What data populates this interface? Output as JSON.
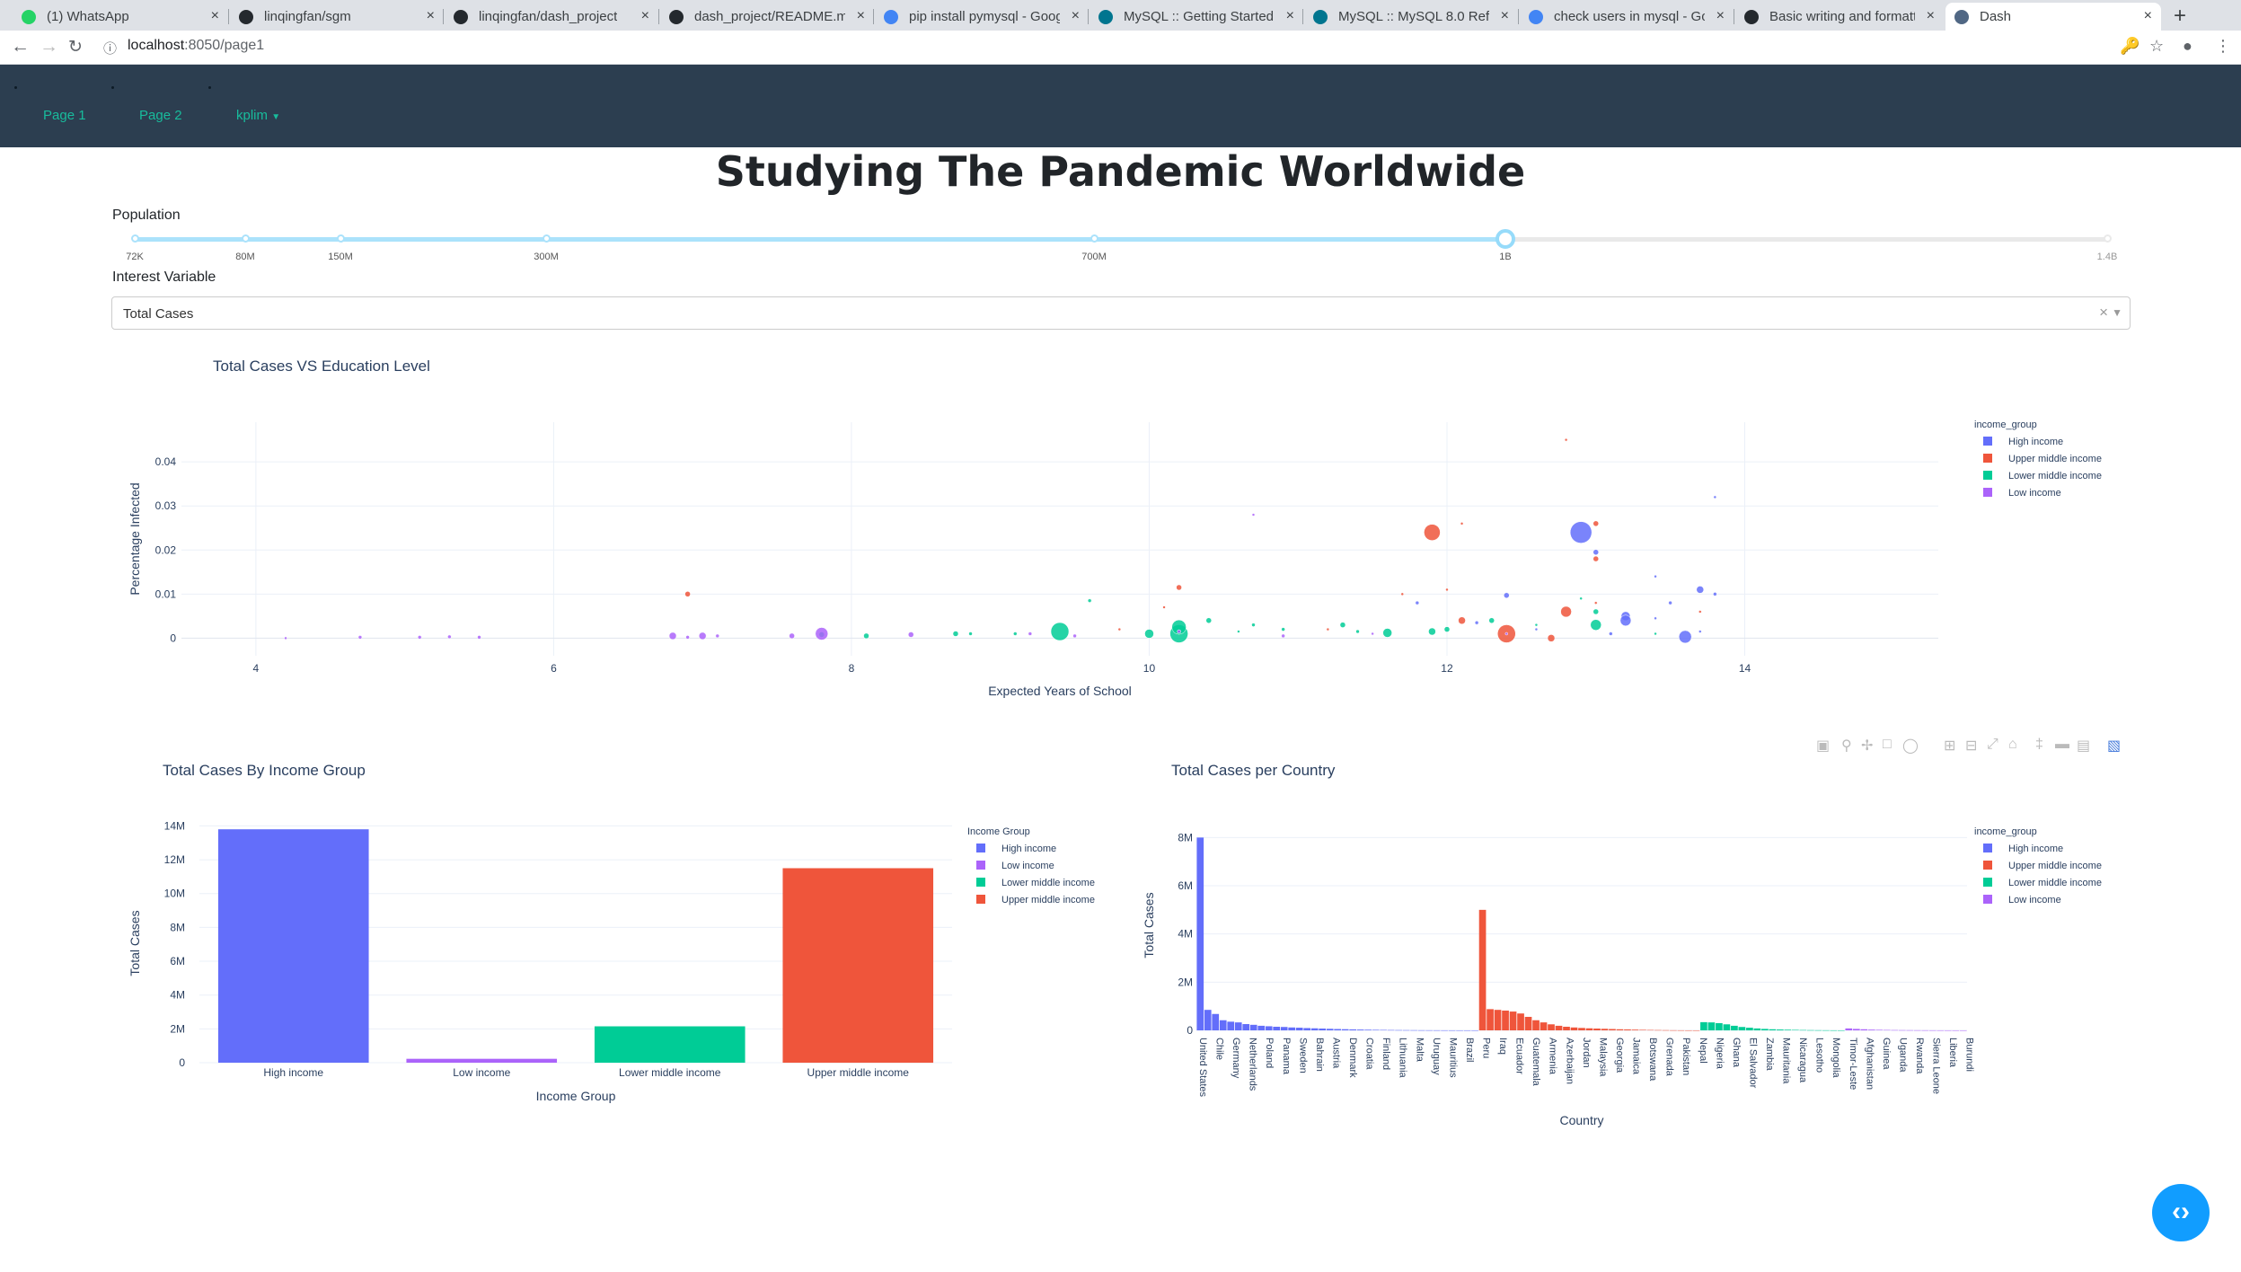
{
  "browser": {
    "tabs": [
      {
        "title": "(1) WhatsApp",
        "icon": "whatsapp-icon",
        "color": "#25d366"
      },
      {
        "title": "linqingfan/sgm",
        "icon": "github-icon",
        "color": "#24292e"
      },
      {
        "title": "linqingfan/dash_project",
        "icon": "github-icon",
        "color": "#24292e"
      },
      {
        "title": "dash_project/README.m",
        "icon": "github-icon",
        "color": "#24292e"
      },
      {
        "title": "pip install pymysql - Goog",
        "icon": "google-icon",
        "color": "#4285f4"
      },
      {
        "title": "MySQL :: Getting Started",
        "icon": "mysql-icon",
        "color": "#00758f"
      },
      {
        "title": "MySQL :: MySQL 8.0 Refer",
        "icon": "mysql-icon",
        "color": "#00758f"
      },
      {
        "title": "check users in mysql - Go",
        "icon": "google-icon",
        "color": "#4285f4"
      },
      {
        "title": "Basic writing and formatt",
        "icon": "github-icon",
        "color": "#24292e"
      },
      {
        "title": "Dash",
        "icon": "dash-icon",
        "color": "#506784"
      }
    ],
    "url_host": "localhost",
    "url_path": ":8050/page1"
  },
  "navbar": {
    "links": [
      "Page 1",
      "Page 2",
      "kplim"
    ]
  },
  "page": {
    "title": "Studying The Pandemic Worldwide",
    "population_label": "Population",
    "slider_marks": [
      "72K",
      "80M",
      "150M",
      "300M",
      "700M",
      "1B",
      "1.4B"
    ],
    "slider_value": "1B",
    "interest_label": "Interest Variable",
    "interest_value": "Total Cases"
  },
  "colors": {
    "high_income": "#636efa",
    "upper_middle_income": "#ef553b",
    "lower_middle_income": "#00cc96",
    "low_income": "#ab63fa",
    "navbar": "#2c3e50",
    "accent": "#18bc9c"
  },
  "chart_data": [
    {
      "type": "scatter",
      "title": "Total Cases VS Education Level",
      "xlabel": "Expected Years of School",
      "ylabel": "Percentage Infected",
      "xlim": [
        3.5,
        15.3
      ],
      "ylim": [
        -0.004,
        0.049
      ],
      "xticks": [
        4,
        6,
        8,
        10,
        12,
        14
      ],
      "yticks": [
        0,
        0.01,
        0.02,
        0.03,
        0.04
      ],
      "ytick_labels": [
        "0",
        "0.01",
        "0.02",
        "0.03",
        "0.04"
      ],
      "legend_title": "income_group",
      "grid": true,
      "series": [
        {
          "name": "High income",
          "points": [
            [
              12.9,
              0.024,
              12
            ],
            [
              12.4,
              0.0097,
              3
            ],
            [
              13.6,
              0.0003,
              7
            ],
            [
              13.2,
              0.005,
              5
            ],
            [
              13.2,
              0.004,
              6
            ],
            [
              13.0,
              0.0195,
              3
            ],
            [
              13.7,
              0.011,
              4
            ],
            [
              13.8,
              0.01,
              2
            ],
            [
              13.5,
              0.008,
              2
            ],
            [
              13.4,
              0.014,
              1.5
            ],
            [
              13.8,
              0.032,
              1.5
            ],
            [
              13.1,
              0.001,
              2
            ],
            [
              12.2,
              0.0035,
              2
            ],
            [
              11.8,
              0.008,
              2
            ],
            [
              12.6,
              0.002,
              1.5
            ],
            [
              13.7,
              0.0015,
              1.5
            ],
            [
              13.4,
              0.0045,
              1.5
            ]
          ]
        },
        {
          "name": "Upper middle income",
          "points": [
            [
              11.9,
              0.024,
              9
            ],
            [
              12.4,
              0.001,
              10
            ],
            [
              6.9,
              0.01,
              3
            ],
            [
              10.2,
              0.0115,
              3
            ],
            [
              12.1,
              0.004,
              4
            ],
            [
              12.8,
              0.006,
              6
            ],
            [
              12.7,
              0.0,
              4
            ],
            [
              13.0,
              0.026,
              3
            ],
            [
              13.0,
              0.018,
              3
            ],
            [
              12.0,
              0.011,
              1.5
            ],
            [
              12.1,
              0.026,
              1.5
            ],
            [
              11.2,
              0.002,
              1.5
            ],
            [
              9.8,
              0.002,
              1.5
            ],
            [
              13.7,
              0.006,
              1.5
            ],
            [
              13.0,
              0.008,
              1.5
            ],
            [
              10.1,
              0.007,
              1.5
            ],
            [
              12.8,
              0.045,
              1.5
            ],
            [
              11.7,
              0.01,
              1.5
            ]
          ]
        },
        {
          "name": "Lower middle income",
          "points": [
            [
              10.2,
              0.001,
              10
            ],
            [
              9.4,
              0.0015,
              10
            ],
            [
              10.2,
              0.0025,
              8
            ],
            [
              10.0,
              0.001,
              5
            ],
            [
              13.0,
              0.003,
              6
            ],
            [
              11.6,
              0.0012,
              5
            ],
            [
              11.9,
              0.0015,
              4
            ],
            [
              12.0,
              0.002,
              3
            ],
            [
              10.4,
              0.004,
              3
            ],
            [
              11.3,
              0.003,
              3
            ],
            [
              12.3,
              0.004,
              3
            ],
            [
              13.0,
              0.006,
              3
            ],
            [
              8.7,
              0.001,
              3
            ],
            [
              8.1,
              0.0005,
              3
            ],
            [
              7.8,
              0.0008,
              3
            ],
            [
              9.1,
              0.001,
              2
            ],
            [
              10.9,
              0.002,
              2
            ],
            [
              10.7,
              0.003,
              2
            ],
            [
              11.4,
              0.0015,
              2
            ],
            [
              9.6,
              0.0085,
              2
            ],
            [
              8.8,
              0.001,
              2
            ],
            [
              10.6,
              0.0015,
              1.5
            ],
            [
              12.6,
              0.003,
              1.5
            ],
            [
              13.4,
              0.001,
              1.5
            ],
            [
              12.9,
              0.009,
              1.5
            ]
          ]
        },
        {
          "name": "Low income",
          "points": [
            [
              7.8,
              0.001,
              7
            ],
            [
              7.0,
              0.0005,
              4
            ],
            [
              6.8,
              0.0005,
              4
            ],
            [
              6.9,
              0.0002,
              2
            ],
            [
              7.6,
              0.0005,
              3
            ],
            [
              7.1,
              0.0005,
              2
            ],
            [
              8.4,
              0.0008,
              3
            ],
            [
              5.3,
              0.0003,
              2
            ],
            [
              5.1,
              0.0002,
              2
            ],
            [
              4.7,
              0.0002,
              2
            ],
            [
              5.5,
              0.0002,
              2
            ],
            [
              4.2,
              0.0,
              1.5
            ],
            [
              9.2,
              0.001,
              2
            ],
            [
              10.2,
              0.0015,
              2
            ],
            [
              9.5,
              0.0005,
              2
            ],
            [
              10.9,
              0.0005,
              2
            ],
            [
              11.5,
              0.001,
              1.5
            ],
            [
              12.4,
              0.001,
              1.5
            ],
            [
              10.7,
              0.028,
              1.5
            ]
          ]
        }
      ]
    },
    {
      "type": "bar",
      "title": "Total Cases By Income Group",
      "xlabel": "Income Group",
      "ylabel": "Total Cases",
      "ylim": [
        0,
        14500000
      ],
      "yticks": [
        0,
        2000000,
        4000000,
        6000000,
        8000000,
        10000000,
        12000000,
        14000000
      ],
      "ytick_labels": [
        "0",
        "2M",
        "4M",
        "6M",
        "8M",
        "10M",
        "12M",
        "14M"
      ],
      "legend_title": "Income Group",
      "categories": [
        "High income",
        "Low income",
        "Lower middle income",
        "Upper middle income"
      ],
      "series": [
        {
          "name": "High income",
          "values": [
            13800000,
            0,
            0,
            0
          ]
        },
        {
          "name": "Low income",
          "values": [
            0,
            230000,
            0,
            0
          ]
        },
        {
          "name": "Lower middle income",
          "values": [
            0,
            0,
            2150000,
            0
          ]
        },
        {
          "name": "Upper middle income",
          "values": [
            0,
            0,
            0,
            11500000
          ]
        }
      ]
    },
    {
      "type": "bar",
      "title": "Total Cases per Country",
      "xlabel": "Country",
      "ylabel": "Total Cases",
      "ylim": [
        0,
        8200000
      ],
      "yticks": [
        0,
        2000000,
        4000000,
        6000000,
        8000000
      ],
      "ytick_labels": [
        "0",
        "2M",
        "4M",
        "6M",
        "8M"
      ],
      "legend_title": "income_group",
      "tick_labels": [
        "United States",
        "Chile",
        "Germany",
        "Netherlands",
        "Poland",
        "Panama",
        "Sweden",
        "Bahrain",
        "Austria",
        "Denmark",
        "Croatia",
        "Finland",
        "Lithuania",
        "Malta",
        "Uruguay",
        "Mauritius",
        "Brazil",
        "Peru",
        "Iraq",
        "Ecuador",
        "Guatemala",
        "Armenia",
        "Azerbaijan",
        "Jordan",
        "Malaysia",
        "Georgia",
        "Jamaica",
        "Botswana",
        "Grenada",
        "Pakistan",
        "Nepal",
        "Nigeria",
        "Ghana",
        "El Salvador",
        "Zambia",
        "Mauritania",
        "Nicaragua",
        "Lesotho",
        "Mongolia",
        "Timor-Leste",
        "Afghanistan",
        "Guinea",
        "Uganda",
        "Rwanda",
        "Sierra Leone",
        "Liberia",
        "Burundi"
      ],
      "series": [
        {
          "name": "High income",
          "values": [
            8000000,
            850000,
            680000,
            420000,
            360000,
            330000,
            260000,
            230000,
            190000,
            170000,
            150000,
            140000,
            120000,
            110000,
            95000,
            85000,
            75000,
            65000,
            55000,
            48000,
            40000,
            33000,
            27000,
            22000,
            18000,
            14000,
            11000,
            9000,
            7000,
            5000,
            4000,
            3000,
            2000,
            1500,
            1000,
            700,
            400
          ]
        },
        {
          "name": "Upper middle income",
          "values": [
            5000000,
            880000,
            850000,
            820000,
            780000,
            700000,
            560000,
            420000,
            330000,
            250000,
            190000,
            150000,
            120000,
            100000,
            85000,
            75000,
            65000,
            55000,
            45000,
            38000,
            30000,
            22000,
            16000,
            12000,
            8000,
            5000,
            3000,
            1500,
            800
          ]
        },
        {
          "name": "Lower middle income",
          "values": [
            340000,
            330000,
            300000,
            250000,
            190000,
            140000,
            110000,
            80000,
            60000,
            45000,
            35000,
            27000,
            20000,
            14000,
            9000,
            6000,
            4000,
            2000,
            1000
          ]
        },
        {
          "name": "Low income",
          "values": [
            80000,
            60000,
            45000,
            30000,
            22000,
            16000,
            12000,
            9000,
            7000,
            5000,
            4000,
            3000,
            2000,
            1500,
            1000,
            600
          ]
        }
      ]
    }
  ]
}
